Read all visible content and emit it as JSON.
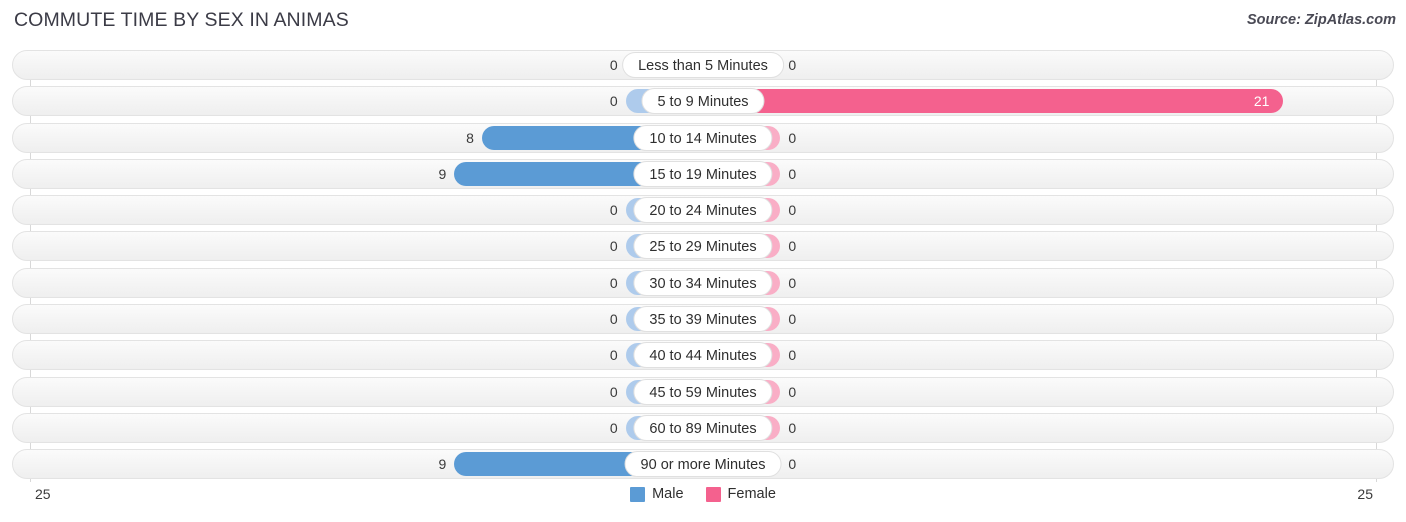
{
  "header": {
    "title": "COMMUTE TIME BY SEX IN ANIMAS",
    "source": "Source: ZipAtlas.com"
  },
  "axis": {
    "left_max": "25",
    "right_max": "25"
  },
  "legend": {
    "items": [
      {
        "label": "Male",
        "color": "#5b9bd5",
        "swatch": "male-swatch"
      },
      {
        "label": "Female",
        "color": "#f4618e",
        "swatch": "female-swatch"
      }
    ]
  },
  "chart_data": {
    "type": "bar",
    "orientation": "horizontal-diverging",
    "title": "COMMUTE TIME BY SEX IN ANIMAS",
    "xlabel": "",
    "ylabel": "",
    "xlim": [
      25,
      25
    ],
    "grid": true,
    "legend_position": "bottom-center",
    "categories": [
      "Less than 5 Minutes",
      "5 to 9 Minutes",
      "10 to 14 Minutes",
      "15 to 19 Minutes",
      "20 to 24 Minutes",
      "25 to 29 Minutes",
      "30 to 34 Minutes",
      "35 to 39 Minutes",
      "40 to 44 Minutes",
      "45 to 59 Minutes",
      "60 to 89 Minutes",
      "90 or more Minutes"
    ],
    "series": [
      {
        "name": "Male",
        "color": "#5b9bd5",
        "values": [
          0,
          0,
          8,
          9,
          0,
          0,
          0,
          0,
          0,
          0,
          0,
          9
        ],
        "labels": [
          "0",
          "0",
          "8",
          "9",
          "0",
          "0",
          "0",
          "0",
          "0",
          "0",
          "0",
          "9"
        ]
      },
      {
        "name": "Female",
        "color": "#f4618e",
        "values": [
          0,
          21,
          0,
          0,
          0,
          0,
          0,
          0,
          0,
          0,
          0,
          0
        ],
        "labels": [
          "0",
          "21",
          "0",
          "0",
          "0",
          "0",
          "0",
          "0",
          "0",
          "0",
          "0",
          "0"
        ]
      }
    ]
  }
}
